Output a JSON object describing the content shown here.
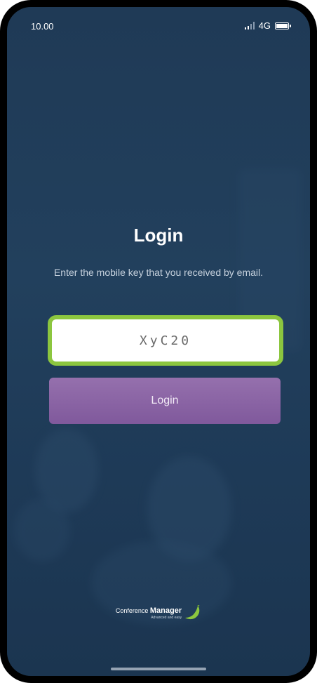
{
  "status_bar": {
    "time": "10.00",
    "network": "4G",
    "icons": [
      "signal-icon",
      "battery-icon"
    ]
  },
  "login": {
    "title": "Login",
    "subtitle": "Enter the mobile key that you received by email.",
    "key_value": "XyC20",
    "button_label": "Login"
  },
  "branding": {
    "name_prefix": "Conference",
    "name_bold": "Manager",
    "tagline": "Advanced and easy",
    "icon": "banana-logo-icon"
  },
  "colors": {
    "background": "#1f3a56",
    "highlight_border": "#8cc63f",
    "button": "#8a64a5",
    "logo": "#8cc63f"
  }
}
